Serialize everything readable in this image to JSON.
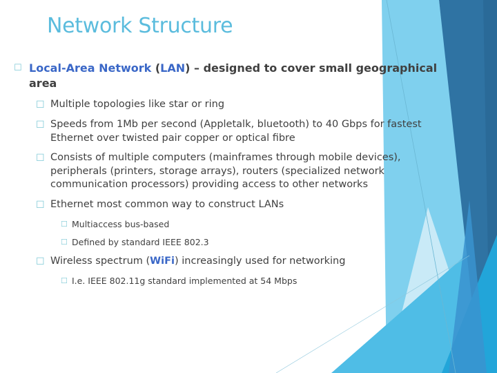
{
  "slide": {
    "title": "Network Structure",
    "accent_color": "#5bbcdd",
    "highlight_color": "#3a67c7",
    "bullet_icon": "hollow-square-bullet",
    "main_bullet": {
      "term": "Local-Area Network",
      "paren_open": " (",
      "abbr": "LAN",
      "rest_line1": ") – designed to cover small geographical",
      "rest_line2": "area"
    },
    "points": [
      {
        "lines": [
          "Multiple topologies like star or ring"
        ]
      },
      {
        "lines": [
          "Speeds from 1Mb per second (Appletalk, bluetooth) to 40 Gbps for fastest",
          "Ethernet over twisted pair copper or optical fibre"
        ]
      },
      {
        "lines": [
          "Consists of multiple computers (mainframes through mobile devices),",
          "peripherals (printers, storage arrays), routers (specialized network",
          "communication processors) providing access to other networks"
        ]
      },
      {
        "lines": [
          "Ethernet most common way to construct LANs"
        ]
      }
    ],
    "ethernet_subpoints": [
      "Multiaccess bus-based",
      "Defined by standard IEEE 802.3"
    ],
    "wireless": {
      "before": "Wireless spectrum (",
      "abbr": "WiFi",
      "after": ") increasingly used for networking"
    },
    "wireless_subpoints": [
      "I.e. IEEE 802.11g standard implemented at 54 Mbps"
    ]
  }
}
